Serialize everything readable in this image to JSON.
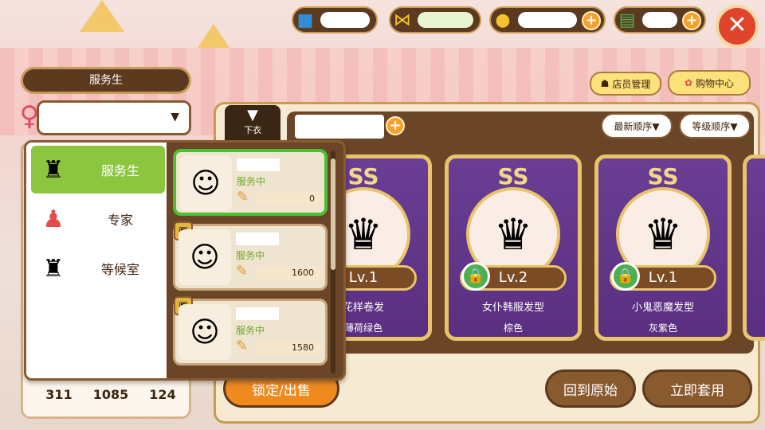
{
  "top": {
    "resources": [
      {
        "icon": "lego-brick-icon",
        "value": ""
      },
      {
        "icon": "ribbon-icon",
        "value": ""
      },
      {
        "icon": "gold-coin-icon",
        "value": ""
      },
      {
        "icon": "cash-icon",
        "value": ""
      }
    ],
    "close": "✕",
    "staff_manage": "店员管理",
    "shop_center": "购物中心"
  },
  "left": {
    "title": "服务生",
    "select_value": "",
    "stats": [
      "311",
      "1085",
      "124"
    ]
  },
  "dropdown": {
    "categories": [
      {
        "label": "服务生",
        "icon": "vest-icon",
        "active": true
      },
      {
        "label": "专家",
        "icon": "chef-shirt-icon",
        "active": false
      },
      {
        "label": "等候室",
        "icon": "vest-icon",
        "active": false
      }
    ],
    "staff": [
      {
        "status": "服务中",
        "value": "0",
        "avatar": "girl-teal-hair-icon",
        "selected": true
      },
      {
        "status": "服务中",
        "value": "1600",
        "avatar": "girl-pink-hair-icon",
        "selected": false
      },
      {
        "status": "服务中",
        "value": "1580",
        "avatar": "girl-pink-hair-icon",
        "selected": false
      }
    ]
  },
  "main": {
    "tab_label": "下衣",
    "sort_new": "最新顺序▼",
    "sort_level": "等级顺序▼",
    "items": [
      {
        "rank": "SS",
        "level": "Lv.1",
        "title": "花样卷发",
        "color": "薄荷绿色",
        "locked": false
      },
      {
        "rank": "SS",
        "level": "Lv.2",
        "title": "女仆韩服发型",
        "color": "棕色",
        "locked": true
      },
      {
        "rank": "SS",
        "level": "Lv.1",
        "title": "小鬼恶魔发型",
        "color": "灰紫色",
        "locked": true
      }
    ],
    "lock_sell": "锁定/出售",
    "revert": "回到原始",
    "apply": "立即套用"
  }
}
